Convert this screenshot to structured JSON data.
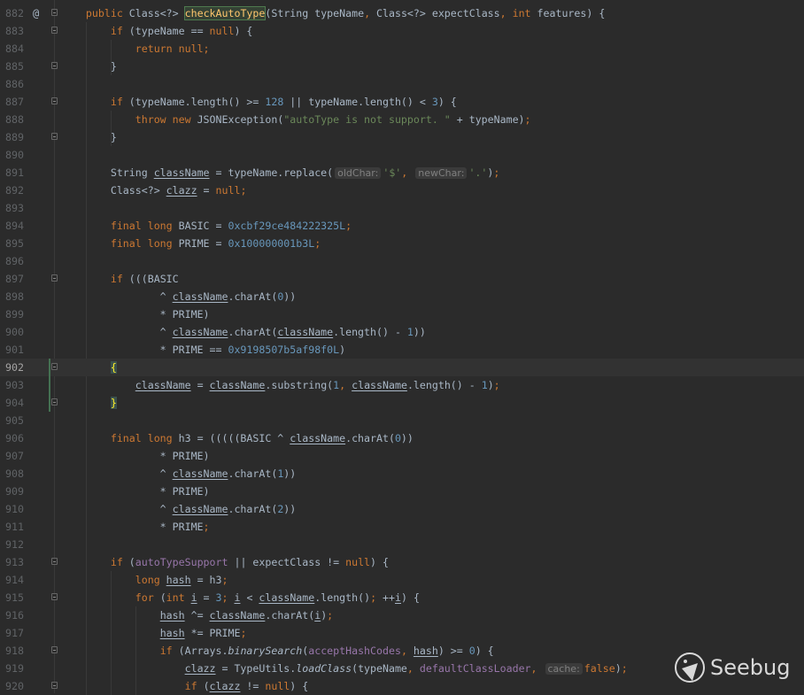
{
  "editor": {
    "current_line": 902,
    "changed_lines": [
      902,
      903,
      904
    ],
    "lines": [
      {
        "n": 882,
        "at": true,
        "fold": true,
        "t": [
          [
            "p",
            "    "
          ],
          [
            "kw",
            "public "
          ],
          [
            "p",
            "Class<?> "
          ],
          [
            "hl",
            "checkAutoType"
          ],
          [
            "p",
            "(String typeName"
          ],
          [
            "kw",
            ", "
          ],
          [
            "p",
            "Class<?> expectClass"
          ],
          [
            "kw",
            ", int "
          ],
          [
            "p",
            "features) {"
          ]
        ]
      },
      {
        "n": 883,
        "fold": true,
        "t": [
          [
            "p",
            "        "
          ],
          [
            "kw",
            "if "
          ],
          [
            "p",
            "(typeName == "
          ],
          [
            "kw",
            "null"
          ],
          [
            "p",
            ") {"
          ]
        ]
      },
      {
        "n": 884,
        "t": [
          [
            "p",
            "            "
          ],
          [
            "kw",
            "return null;"
          ]
        ]
      },
      {
        "n": 885,
        "fold": true,
        "t": [
          [
            "p",
            "        }"
          ]
        ]
      },
      {
        "n": 886,
        "t": []
      },
      {
        "n": 887,
        "fold": true,
        "t": [
          [
            "p",
            "        "
          ],
          [
            "kw",
            "if "
          ],
          [
            "p",
            "(typeName.length() >= "
          ],
          [
            "num",
            "128"
          ],
          [
            "p",
            " || typeName.length() < "
          ],
          [
            "num",
            "3"
          ],
          [
            "p",
            ") {"
          ]
        ]
      },
      {
        "n": 888,
        "t": [
          [
            "p",
            "            "
          ],
          [
            "kw",
            "throw new "
          ],
          [
            "p",
            "JSONException("
          ],
          [
            "str",
            "\"autoType is not support. \""
          ],
          [
            "p",
            " + typeName)"
          ],
          [
            "kw",
            ";"
          ]
        ]
      },
      {
        "n": 889,
        "fold": true,
        "t": [
          [
            "p",
            "        }"
          ]
        ]
      },
      {
        "n": 890,
        "t": []
      },
      {
        "n": 891,
        "t": [
          [
            "p",
            "        String "
          ],
          [
            "lv",
            "className"
          ],
          [
            "p",
            " = typeName.replace("
          ],
          [
            "hint",
            "oldChar:"
          ],
          [
            "str",
            "'$'"
          ],
          [
            "kw",
            ", "
          ],
          [
            "hint",
            "newChar:"
          ],
          [
            "str",
            "'.'"
          ],
          [
            "p",
            ")"
          ],
          [
            "kw",
            ";"
          ]
        ]
      },
      {
        "n": 892,
        "t": [
          [
            "p",
            "        Class<?> "
          ],
          [
            "lv",
            "clazz"
          ],
          [
            "p",
            " = "
          ],
          [
            "kw",
            "null;"
          ]
        ]
      },
      {
        "n": 893,
        "t": []
      },
      {
        "n": 894,
        "t": [
          [
            "p",
            "        "
          ],
          [
            "kw",
            "final long "
          ],
          [
            "p",
            "BASIC = "
          ],
          [
            "num",
            "0xcbf29ce484222325L"
          ],
          [
            "kw",
            ";"
          ]
        ]
      },
      {
        "n": 895,
        "t": [
          [
            "p",
            "        "
          ],
          [
            "kw",
            "final long "
          ],
          [
            "p",
            "PRIME = "
          ],
          [
            "num",
            "0x100000001b3L"
          ],
          [
            "kw",
            ";"
          ]
        ]
      },
      {
        "n": 896,
        "t": []
      },
      {
        "n": 897,
        "fold": true,
        "t": [
          [
            "p",
            "        "
          ],
          [
            "kw",
            "if "
          ],
          [
            "p",
            "(((BASIC"
          ]
        ]
      },
      {
        "n": 898,
        "t": [
          [
            "p",
            "                ^ "
          ],
          [
            "lv",
            "className"
          ],
          [
            "p",
            ".charAt("
          ],
          [
            "num",
            "0"
          ],
          [
            "p",
            "))"
          ]
        ]
      },
      {
        "n": 899,
        "t": [
          [
            "p",
            "                * PRIME)"
          ]
        ]
      },
      {
        "n": 900,
        "t": [
          [
            "p",
            "                ^ "
          ],
          [
            "lv",
            "className"
          ],
          [
            "p",
            ".charAt("
          ],
          [
            "lv",
            "className"
          ],
          [
            "p",
            ".length() - "
          ],
          [
            "num",
            "1"
          ],
          [
            "p",
            "))"
          ]
        ]
      },
      {
        "n": 901,
        "t": [
          [
            "p",
            "                * PRIME == "
          ],
          [
            "num",
            "0x9198507b5af98f0L"
          ],
          [
            "p",
            ")"
          ]
        ]
      },
      {
        "n": 902,
        "fold": true,
        "t": [
          [
            "p",
            "        "
          ],
          [
            "brace",
            "{"
          ]
        ]
      },
      {
        "n": 903,
        "t": [
          [
            "p",
            "            "
          ],
          [
            "lv",
            "className"
          ],
          [
            "p",
            " = "
          ],
          [
            "lv",
            "className"
          ],
          [
            "p",
            ".substring("
          ],
          [
            "num",
            "1"
          ],
          [
            "kw",
            ", "
          ],
          [
            "lv",
            "className"
          ],
          [
            "p",
            ".length() - "
          ],
          [
            "num",
            "1"
          ],
          [
            "p",
            ")"
          ],
          [
            "kw",
            ";"
          ]
        ]
      },
      {
        "n": 904,
        "fold": true,
        "t": [
          [
            "p",
            "        "
          ],
          [
            "brace",
            "}"
          ]
        ]
      },
      {
        "n": 905,
        "t": []
      },
      {
        "n": 906,
        "t": [
          [
            "p",
            "        "
          ],
          [
            "kw",
            "final long "
          ],
          [
            "p",
            "h3 = (((((BASIC ^ "
          ],
          [
            "lv",
            "className"
          ],
          [
            "p",
            ".charAt("
          ],
          [
            "num",
            "0"
          ],
          [
            "p",
            "))"
          ]
        ]
      },
      {
        "n": 907,
        "t": [
          [
            "p",
            "                * PRIME)"
          ]
        ]
      },
      {
        "n": 908,
        "t": [
          [
            "p",
            "                ^ "
          ],
          [
            "lv",
            "className"
          ],
          [
            "p",
            ".charAt("
          ],
          [
            "num",
            "1"
          ],
          [
            "p",
            "))"
          ]
        ]
      },
      {
        "n": 909,
        "t": [
          [
            "p",
            "                * PRIME)"
          ]
        ]
      },
      {
        "n": 910,
        "t": [
          [
            "p",
            "                ^ "
          ],
          [
            "lv",
            "className"
          ],
          [
            "p",
            ".charAt("
          ],
          [
            "num",
            "2"
          ],
          [
            "p",
            "))"
          ]
        ]
      },
      {
        "n": 911,
        "t": [
          [
            "p",
            "                * PRIME"
          ],
          [
            "kw",
            ";"
          ]
        ]
      },
      {
        "n": 912,
        "t": []
      },
      {
        "n": 913,
        "fold": true,
        "t": [
          [
            "p",
            "        "
          ],
          [
            "kw",
            "if "
          ],
          [
            "p",
            "("
          ],
          [
            "fld",
            "autoTypeSupport"
          ],
          [
            "p",
            " || expectClass != "
          ],
          [
            "kw",
            "null"
          ],
          [
            "p",
            ") {"
          ]
        ]
      },
      {
        "n": 914,
        "t": [
          [
            "p",
            "            "
          ],
          [
            "kw",
            "long "
          ],
          [
            "lv",
            "hash"
          ],
          [
            "p",
            " = h3"
          ],
          [
            "kw",
            ";"
          ]
        ]
      },
      {
        "n": 915,
        "fold": true,
        "t": [
          [
            "p",
            "            "
          ],
          [
            "kw",
            "for "
          ],
          [
            "p",
            "("
          ],
          [
            "kw",
            "int "
          ],
          [
            "lv",
            "i"
          ],
          [
            "p",
            " = "
          ],
          [
            "num",
            "3"
          ],
          [
            "kw",
            "; "
          ],
          [
            "lv",
            "i"
          ],
          [
            "p",
            " < "
          ],
          [
            "lv",
            "className"
          ],
          [
            "p",
            ".length()"
          ],
          [
            "kw",
            "; "
          ],
          [
            "p",
            "++"
          ],
          [
            "lv",
            "i"
          ],
          [
            "p",
            ") {"
          ]
        ]
      },
      {
        "n": 916,
        "t": [
          [
            "p",
            "                "
          ],
          [
            "lv",
            "hash"
          ],
          [
            "p",
            " ^= "
          ],
          [
            "lv",
            "className"
          ],
          [
            "p",
            ".charAt("
          ],
          [
            "lv",
            "i"
          ],
          [
            "p",
            ")"
          ],
          [
            "kw",
            ";"
          ]
        ]
      },
      {
        "n": 917,
        "t": [
          [
            "p",
            "                "
          ],
          [
            "lv",
            "hash"
          ],
          [
            "p",
            " *= PRIME"
          ],
          [
            "kw",
            ";"
          ]
        ]
      },
      {
        "n": 918,
        "fold": true,
        "t": [
          [
            "p",
            "                "
          ],
          [
            "kw",
            "if "
          ],
          [
            "p",
            "(Arrays."
          ],
          [
            "sm",
            "binarySearch"
          ],
          [
            "p",
            "("
          ],
          [
            "fld",
            "acceptHashCodes"
          ],
          [
            "kw",
            ", "
          ],
          [
            "lv",
            "hash"
          ],
          [
            "p",
            ") >= "
          ],
          [
            "num",
            "0"
          ],
          [
            "p",
            ") {"
          ]
        ]
      },
      {
        "n": 919,
        "t": [
          [
            "p",
            "                    "
          ],
          [
            "lv",
            "clazz"
          ],
          [
            "p",
            " = TypeUtils."
          ],
          [
            "sm",
            "loadClass"
          ],
          [
            "p",
            "(typeName"
          ],
          [
            "kw",
            ", "
          ],
          [
            "fld",
            "defaultClassLoader"
          ],
          [
            "kw",
            ", "
          ],
          [
            "hint",
            "cache:"
          ],
          [
            "kw",
            "false"
          ],
          [
            "p",
            ")"
          ],
          [
            "kw",
            ";"
          ]
        ]
      },
      {
        "n": 920,
        "fold": true,
        "t": [
          [
            "p",
            "                    "
          ],
          [
            "kw",
            "if "
          ],
          [
            "p",
            "("
          ],
          [
            "lv",
            "clazz"
          ],
          [
            "p",
            " != "
          ],
          [
            "kw",
            "null"
          ],
          [
            "p",
            ") {"
          ]
        ]
      }
    ]
  },
  "watermark": {
    "text": "Seebug"
  }
}
